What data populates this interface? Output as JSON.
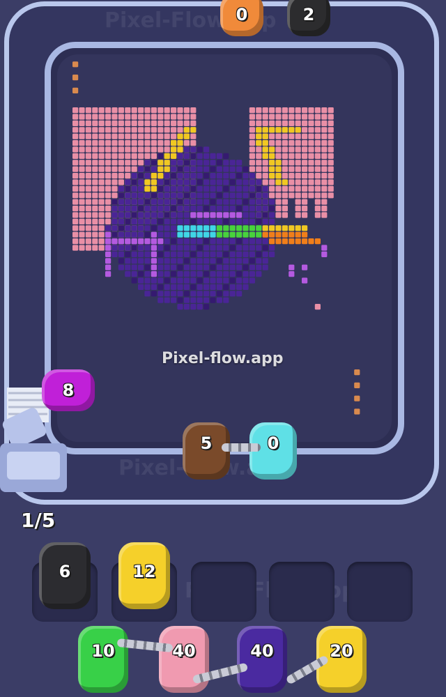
{
  "watermark": {
    "center_text": "Pixel-flow.app",
    "repeat_text": "Pixel-Flow.app"
  },
  "queue_counter": "1/5",
  "pigs": {
    "track_top_left": {
      "number": "0",
      "color": "#f08a3a"
    },
    "track_top_right": {
      "number": "2",
      "color": "#2c2c2e"
    },
    "launcher": {
      "number": "8",
      "color": "#c020d8"
    },
    "track_bottom_left": {
      "number": "5",
      "color": "#7a4a2a"
    },
    "track_bottom_right": {
      "number": "0",
      "color": "#5fe0e6"
    },
    "slot1": {
      "number": "6",
      "color": "#2c2c30"
    },
    "slot2": {
      "number": "12",
      "color": "#f5d02a"
    },
    "queue1": {
      "number": "10",
      "color": "#38d048"
    },
    "queue2": {
      "number": "40",
      "color": "#f09ab0"
    },
    "queue3": {
      "number": "40",
      "color": "#4a2aa0"
    },
    "queue4": {
      "number": "20",
      "color": "#f5d02a"
    }
  },
  "colors": {
    "background": "#3b3d66",
    "track": "#b9c7ec"
  }
}
